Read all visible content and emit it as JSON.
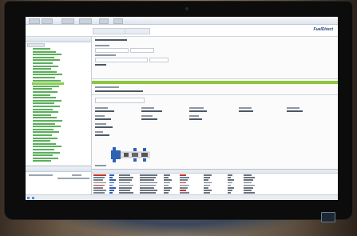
{
  "app": {
    "brand": "FuelDirect",
    "window_tabs": [
      "",
      "",
      "",
      "",
      ""
    ]
  },
  "left_pane": {
    "title": "",
    "tree_rows": 40
  },
  "colors": {
    "accent_green": "#8dc63f",
    "tree_green": "#3ea03e",
    "brand_blue": "#1e3a78"
  },
  "icons": [
    "vehicle-diagram-icon",
    "monitor-camera-icon",
    "windows-logo-icon"
  ]
}
